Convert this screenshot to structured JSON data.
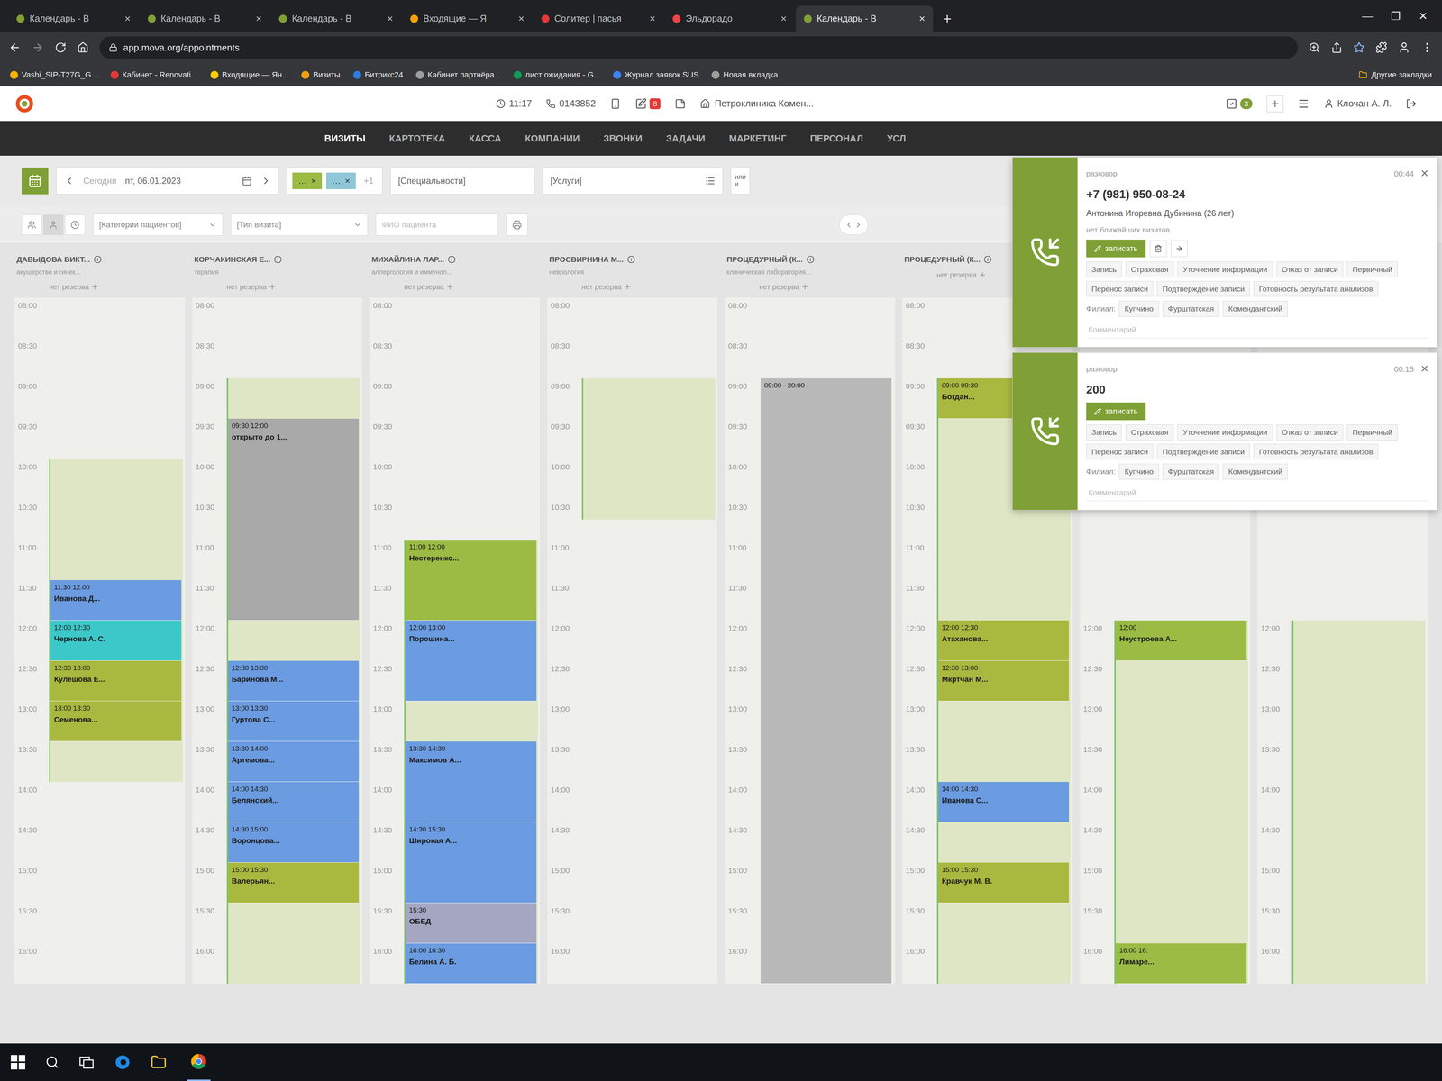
{
  "browser": {
    "controls": [
      "—",
      "❐",
      "✕"
    ],
    "tab_close": "×",
    "new_tab": "+",
    "tabs": [
      {
        "label": "Календарь - В",
        "selected": false
      },
      {
        "label": "Календарь - В",
        "selected": false
      },
      {
        "label": "Календарь - В",
        "selected": false
      },
      {
        "label": "Входящие — Я",
        "selected": false
      },
      {
        "label": "Солитер | пасья",
        "selected": false
      },
      {
        "label": "Эльдорадо",
        "selected": false
      },
      {
        "label": "Календарь - В",
        "selected": true
      }
    ],
    "address": "app.mova.org/appointments",
    "bookmarks": [
      "Vashi_SIP-T27G_G...",
      "Кабинет - Renovati...",
      "Входящие — Ян...",
      "Визиты",
      "Битрикс24",
      "Кабинет партнёра...",
      "лист ожидания - G...",
      "Журнал заявок SUS",
      "Новая вкладка"
    ],
    "other_bookmarks": "Другие закладки"
  },
  "app": {
    "time": "11:17",
    "phone": "0143852",
    "notes_badge": "8",
    "clinic": "Петроклиника Комен...",
    "tasks_badge": "3",
    "user": "Клочан А. Л.",
    "nav": [
      {
        "label": "ВИЗИТЫ",
        "selected": true
      },
      {
        "label": "КАРТОТЕКА",
        "selected": false
      },
      {
        "label": "КАССА",
        "selected": false
      },
      {
        "label": "КОМПАНИИ",
        "selected": false
      },
      {
        "label": "ЗВОНКИ",
        "selected": false
      },
      {
        "label": "ЗАДАЧИ",
        "selected": false
      },
      {
        "label": "МАРКЕТИНГ",
        "selected": false
      },
      {
        "label": "ПЕРСОНАЛ",
        "selected": false
      },
      {
        "label": "УСЛ",
        "selected": false
      }
    ]
  },
  "filters": {
    "today": "Сегодня",
    "date": "пт, 06.01.2023",
    "chips": [
      {
        "label": "…",
        "color": "#9bbb45"
      },
      {
        "label": "…",
        "color": "#8fc7d6"
      }
    ],
    "chip_close": "×",
    "more": "+1",
    "specialties": "[Специальности]",
    "services": "[Услуги]",
    "logic": [
      "или",
      "и"
    ],
    "patient_categories": "[Категории пациентов]",
    "visit_type": "[Тип визита]",
    "patient_search": {
      "placeholder": "ФИО пациента"
    }
  },
  "calendar": {
    "reserve": "нет резерва",
    "reserve_add": "+",
    "columns": [
      {
        "name": "ДАВЫДОВА ВИКТ...",
        "subtitle": "акушерство и гинек...",
        "times": [
          "08:00",
          "08:30",
          "09:00",
          "09:30",
          "10:00",
          "10:30",
          "11:00",
          "11:30",
          "12:00",
          "12:30",
          "13:00",
          "13:30",
          "14:00",
          "14:30",
          "15:00",
          "15:30",
          "16:00"
        ],
        "shifts": [
          {
            "from": "10:00",
            "to": "14:00",
            "color": "#dfe6c5"
          }
        ],
        "appointments": [
          {
            "time": "11:30 12:00",
            "label": "Иванова Д...",
            "color": "#6b9be0"
          },
          {
            "time": "12:00 12:30",
            "label": "Чернова А. С.",
            "color": "#3cc8c8"
          },
          {
            "time": "12:30 13:00",
            "label": "Кулешова Е...",
            "color": "#a9b83f"
          },
          {
            "time": "13:00 13:30",
            "label": "Семенова...",
            "color": "#a9b83f"
          }
        ]
      },
      {
        "name": "КОРЧАКИНСКАЯ Е...",
        "subtitle": "терапия",
        "times": [
          "08:00",
          "08:30",
          "09:00",
          "09:30",
          "10:00",
          "10:30",
          "11:00",
          "11:30",
          "12:00",
          "12:30",
          "13:00",
          "13:30",
          "14:00",
          "14:30",
          "15:00",
          "15:30",
          "16:00"
        ],
        "shifts": [
          {
            "from": "09:00",
            "to": "16:30",
            "color": "#dfe6c5"
          }
        ],
        "appointments": [
          {
            "time": "09:30 12:00",
            "label": "открыто до 1...",
            "color": "#a9a9a9"
          },
          {
            "time": "12:30 13:00",
            "label": "Баринова М...",
            "color": "#6b9be0"
          },
          {
            "time": "13:00 13:30",
            "label": "Гуртова С...",
            "color": "#6b9be0"
          },
          {
            "time": "13:30 14:00",
            "label": "Артемова...",
            "color": "#6b9be0"
          },
          {
            "time": "14:00 14:30",
            "label": "Белянский...",
            "color": "#6b9be0"
          },
          {
            "time": "14:30 15:00",
            "label": "Воронцова...",
            "color": "#6b9be0"
          },
          {
            "time": "15:00 15:30",
            "label": "Валерьян...",
            "color": "#a9b83f"
          }
        ]
      },
      {
        "name": "МИХАЙЛИНА ЛАР...",
        "subtitle": "аллергология и иммунол...",
        "times": [
          "08:00",
          "08:30",
          "09:00",
          "09:30",
          "10:00",
          "10:30",
          "11:00",
          "11:30",
          "12:00",
          "12:30",
          "13:00",
          "13:30",
          "14:00",
          "14:30",
          "15:00",
          "15:30",
          "16:00"
        ],
        "shifts": [
          {
            "from": "11:00",
            "to": "16:30",
            "color": "#dfe6c5"
          }
        ],
        "appointments": [
          {
            "time": "11:00 12:00",
            "label": "Нестеренко...",
            "color": "#9bbb45"
          },
          {
            "time": "12:00 13:00",
            "label": "Порошина...",
            "color": "#6b9be0"
          },
          {
            "time": "13:30 14:30",
            "label": "Максимов А...",
            "color": "#6b9be0"
          },
          {
            "time": "14:30 15:30",
            "label": "Широкая А...",
            "color": "#6b9be0"
          },
          {
            "time": "15:30",
            "label": "ОБЕД",
            "color": "#a4a6c2"
          },
          {
            "time": "16:00 16:30",
            "label": "Белина А. Б.",
            "color": "#6b9be0"
          }
        ]
      },
      {
        "name": "ПРОСВИРНИНА М...",
        "subtitle": "неврология",
        "times": [
          "08:00",
          "08:30",
          "09:00",
          "09:30",
          "10:00",
          "10:30",
          "11:00",
          "11:30",
          "12:00",
          "12:30",
          "13:00",
          "13:30",
          "14:00",
          "14:30",
          "15:00",
          "15:30",
          "16:00"
        ],
        "shifts": [
          {
            "from": "09:00",
            "to": "10:45",
            "color": "#dfe6c5"
          }
        ],
        "appointments": []
      },
      {
        "name": "ПРОЦЕДУРНЫЙ (К...",
        "subtitle": "клиническая лаборатория...",
        "times": [
          "08:00",
          "08:30",
          "09:00",
          "09:30",
          "10:00",
          "10:30",
          "11:00",
          "11:30",
          "12:00",
          "12:30",
          "13:00",
          "13:30",
          "14:00",
          "14:30",
          "15:00",
          "15:30",
          "16:00"
        ],
        "shifts": [],
        "appointments": [
          {
            "time": "09:00 - 20:00",
            "label": "",
            "color": "#b9b9b9"
          }
        ]
      },
      {
        "name": "ПРОЦЕДУРНЫЙ (К...",
        "subtitle": "",
        "times": [
          "08:00",
          "08:30",
          "09:00",
          "09:30",
          "10:00",
          "10:30",
          "11:00",
          "11:30",
          "12:00",
          "12:30",
          "13:00",
          "13:30",
          "14:00",
          "14:30",
          "15:00",
          "15:30",
          "16:00"
        ],
        "shifts": [
          {
            "from": "09:00",
            "to": "16:30",
            "color": "#dfe6c5"
          }
        ],
        "appointments": [
          {
            "time": "09:00 09:30",
            "label": "Богдан...",
            "color": "#a9b83f"
          },
          {
            "time": "12:00 12:30",
            "label": "Атаханова...",
            "color": "#a9b83f"
          },
          {
            "time": "12:30 13:00",
            "label": "Мкртчан М...",
            "color": "#a9b83f"
          },
          {
            "time": "14:00 14:30",
            "label": "Иванова С...",
            "color": "#6b9be0"
          },
          {
            "time": "15:00 15:30",
            "label": "Кравчук М. В.",
            "color": "#a9b83f"
          }
        ]
      },
      {
        "name": "",
        "subtitle": "",
        "times": [
          "12:00",
          "12:30",
          "13:00",
          "13:30",
          "14:00",
          "14:30",
          "15:00",
          "15:30",
          "16:00"
        ],
        "shifts": [
          {
            "from": "12:00",
            "to": "16:30",
            "color": "#dfe6c5"
          }
        ],
        "appointments": [
          {
            "time": "12:00",
            "label": "Неустроева А...",
            "color": "#9bbb45"
          },
          {
            "time": "16:00 16:",
            "label": "Лимаре...",
            "color": "#9bbb45"
          }
        ]
      },
      {
        "name": "",
        "subtitle": "",
        "times": [
          "12:00",
          "12:30",
          "13:00",
          "13:30",
          "14:00",
          "14:30",
          "15:00",
          "15:30",
          "16:00"
        ],
        "shifts": [
          {
            "from": "12:00",
            "to": "16:30",
            "color": "#dfe6c5"
          }
        ],
        "appointments": []
      }
    ]
  },
  "calls": [
    {
      "status": "разговор",
      "duration": "00:44",
      "close": "✕",
      "caller": "+7 (981) 950-08-24",
      "patient": "Антонина Игоревна Дубинина (26 лет)",
      "note": "нет ближайших визитов",
      "book": "записать",
      "has_actions": true,
      "tags": [
        {
          "label": "Запись",
          "selected": false
        },
        {
          "label": "Страховая",
          "selected": false
        },
        {
          "label": "Уточнение информации",
          "selected": false
        },
        {
          "label": "Отказ от записи",
          "selected": false
        },
        {
          "label": "Первичный",
          "selected": false
        },
        {
          "label": "Перенос записи",
          "selected": false
        },
        {
          "label": "Подтверждение записи",
          "selected": false
        },
        {
          "label": "Готовность результата анализов",
          "selected": false
        }
      ],
      "branch_label": "Филиал:",
      "branches": [
        {
          "label": "Купчино",
          "selected": false
        },
        {
          "label": "Фурштатская",
          "selected": false
        },
        {
          "label": "Комендантский",
          "selected": false
        }
      ],
      "comment_placeholder": "Комментарий"
    },
    {
      "status": "разговор",
      "duration": "00:15",
      "close": "✕",
      "caller": "200",
      "patient": "",
      "note": "",
      "book": "записать",
      "has_actions": false,
      "tags": [
        {
          "label": "Запись",
          "selected": false
        },
        {
          "label": "Страховая",
          "selected": false
        },
        {
          "label": "Уточнение информации",
          "selected": false
        },
        {
          "label": "Отказ от записи",
          "selected": false
        },
        {
          "label": "Первичный",
          "selected": false
        },
        {
          "label": "Перенос записи",
          "selected": false
        },
        {
          "label": "Подтверждение записи",
          "selected": false
        },
        {
          "label": "Готовность результата анализов",
          "selected": false
        }
      ],
      "branch_label": "Филиал:",
      "branches": [
        {
          "label": "Купчино",
          "selected": false
        },
        {
          "label": "Фурштатская",
          "selected": false
        },
        {
          "label": "Комендантский",
          "selected": false
        }
      ],
      "comment_placeholder": "Комментарий"
    }
  ]
}
